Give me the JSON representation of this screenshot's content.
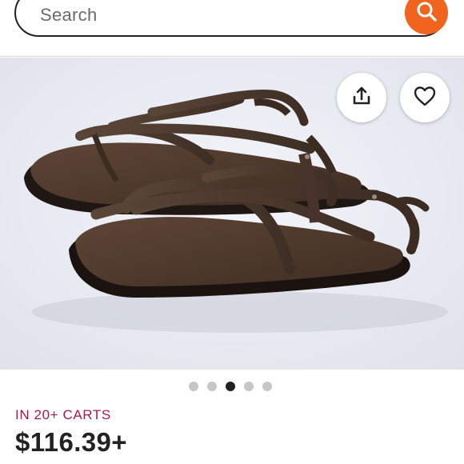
{
  "search": {
    "placeholder": "Search",
    "icon": "search-icon",
    "button_color": "#f1641e"
  },
  "listing": {
    "image_alt": "Brown leather strappy sandals",
    "actions": {
      "share_icon": "share-icon",
      "favorite_icon": "heart-icon"
    },
    "carousel": {
      "total": 5,
      "active_index": 3
    },
    "cart_badge": "IN 20+ CARTS",
    "price": "$116.39+"
  },
  "colors": {
    "badge": "#a61a4a",
    "accent": "#f1641e",
    "text": "#222222"
  }
}
